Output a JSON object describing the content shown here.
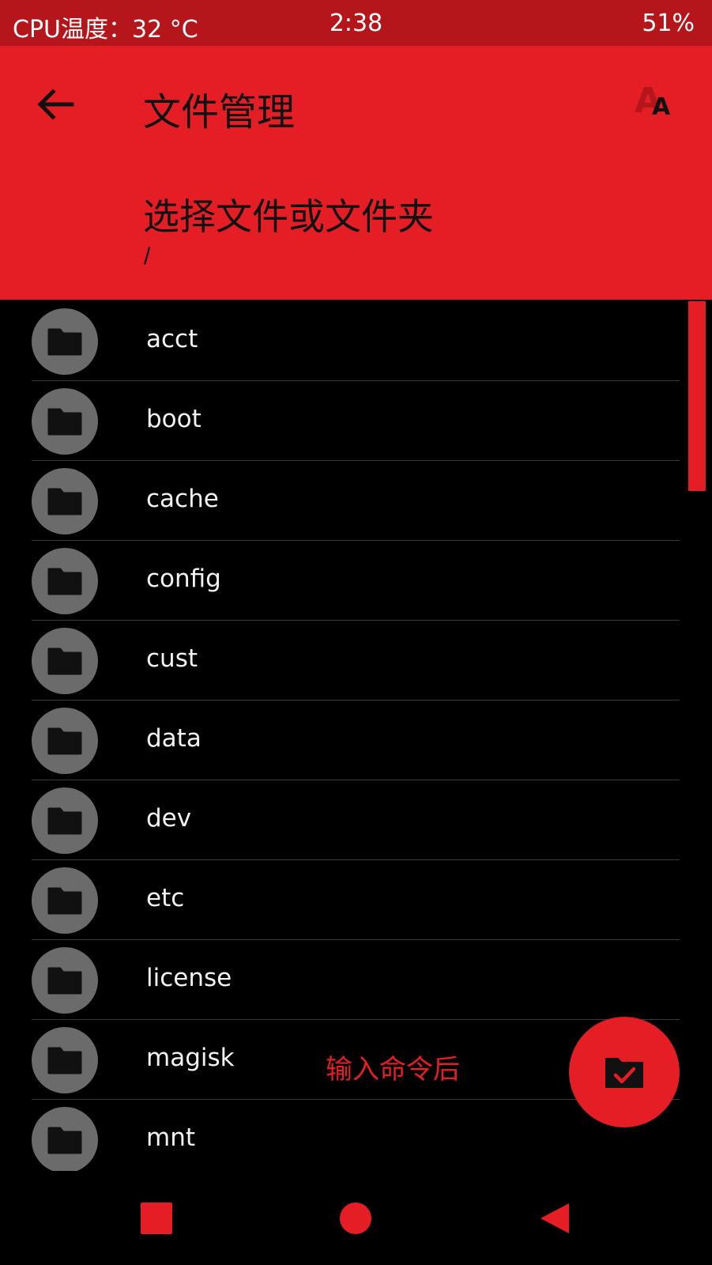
{
  "status_bar": {
    "cpu_temp": "CPU温度：32 °C",
    "time": "2:38",
    "battery": "51%"
  },
  "app_bar": {
    "title": "文件管理",
    "subtitle": "选择文件或文件夹",
    "path": "/",
    "icons": {
      "back": "arrow-left-icon",
      "font_size": "font-size-icon"
    }
  },
  "files": [
    {
      "name": "acct",
      "icon": "folder-icon"
    },
    {
      "name": "boot",
      "icon": "folder-icon"
    },
    {
      "name": "cache",
      "icon": "folder-icon"
    },
    {
      "name": "config",
      "icon": "folder-icon"
    },
    {
      "name": "cust",
      "icon": "folder-icon"
    },
    {
      "name": "data",
      "icon": "folder-icon"
    },
    {
      "name": "dev",
      "icon": "folder-icon"
    },
    {
      "name": "etc",
      "icon": "folder-icon"
    },
    {
      "name": "license",
      "icon": "folder-icon"
    },
    {
      "name": "magisk",
      "icon": "folder-icon"
    },
    {
      "name": "mnt",
      "icon": "folder-icon"
    }
  ],
  "overlay_note": "输入命令后",
  "fab": {
    "icon": "folder-check-icon"
  },
  "nav": {
    "recents": "square-icon",
    "home": "circle-icon",
    "back": "triangle-back-icon"
  },
  "colors": {
    "accent": "#e41e24",
    "status_bar": "#b5161b",
    "avatar": "#6b6b6b",
    "background": "#000000"
  }
}
